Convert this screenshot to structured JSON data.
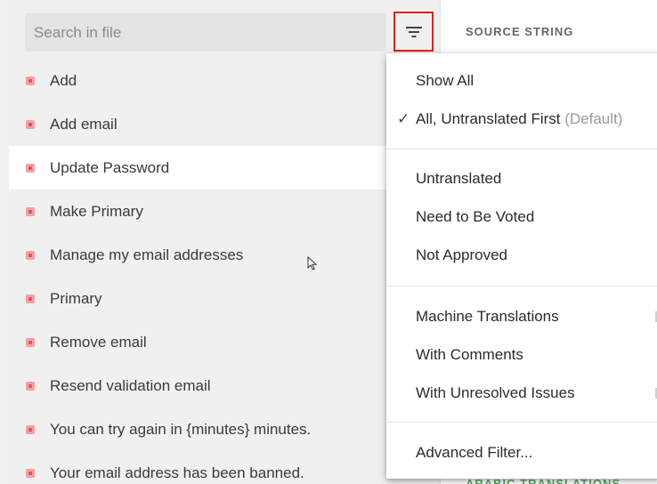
{
  "search": {
    "placeholder": "Search in file"
  },
  "filter_button": {
    "icon": "filter-icon",
    "highlight_color": "#e02020"
  },
  "strings": [
    {
      "text": "Add",
      "status": "untranslated"
    },
    {
      "text": "Add email",
      "status": "untranslated"
    },
    {
      "text": "Update Password",
      "status": "untranslated",
      "selected": true
    },
    {
      "text": "Make Primary",
      "status": "untranslated"
    },
    {
      "text": "Manage my email addresses",
      "status": "untranslated"
    },
    {
      "text": "Primary",
      "status": "untranslated"
    },
    {
      "text": "Remove email",
      "status": "untranslated"
    },
    {
      "text": "Resend validation email",
      "status": "untranslated"
    },
    {
      "text": "You can try again in {minutes} minutes.",
      "status": "untranslated"
    },
    {
      "text": "Your email address has been banned.",
      "status": "untranslated"
    }
  ],
  "right_panel": {
    "source_header": "SOURCE STRING",
    "bottom_label": "ARABIC TRANSLATIONS"
  },
  "filter_menu": {
    "group1": [
      {
        "label": "Show All",
        "checked": false
      },
      {
        "label": "All, Untranslated First",
        "suffix": "(Default)",
        "checked": true
      }
    ],
    "group2": [
      {
        "label": "Untranslated"
      },
      {
        "label": "Need to Be Voted"
      },
      {
        "label": "Not Approved"
      }
    ],
    "group3": [
      {
        "label": "Machine Translations"
      },
      {
        "label": "With Comments"
      },
      {
        "label": "With Unresolved Issues"
      }
    ],
    "group4": [
      {
        "label": "Advanced Filter..."
      }
    ]
  },
  "colors": {
    "status_untranslated": "#e35258",
    "selected_row_bg": "#ffffff",
    "panel_bg": "#f0f0f0"
  }
}
